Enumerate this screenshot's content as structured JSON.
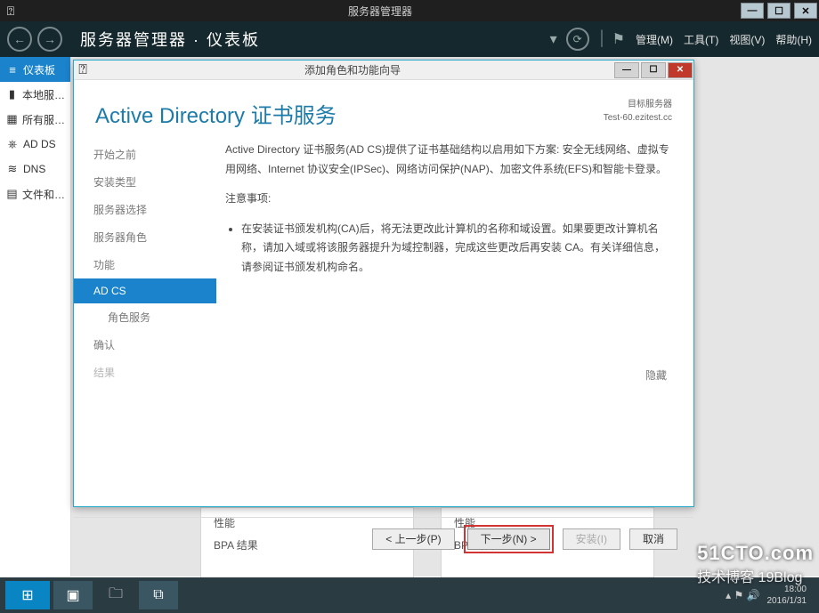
{
  "outerWindow": {
    "title": "服务器管理器",
    "breadcrumb": "服务器管理器 · 仪表板",
    "menus": {
      "manage": "管理(M)",
      "tools": "工具(T)",
      "view": "视图(V)",
      "help": "帮助(H)"
    }
  },
  "sidebar": {
    "items": [
      {
        "icon": "≡",
        "label": "仪表板",
        "sel": true
      },
      {
        "icon": "▮",
        "label": "本地服…"
      },
      {
        "icon": "▦",
        "label": "所有服…"
      },
      {
        "icon": "⎈",
        "label": "AD DS"
      },
      {
        "icon": "≋",
        "label": "DNS"
      },
      {
        "icon": "▤",
        "label": "文件和…"
      }
    ]
  },
  "panels": {
    "a_line1": "性能",
    "a_line2": "BPA 结果",
    "b_line1": "性能",
    "b_line2": "BPA 结果"
  },
  "wizard": {
    "title": "添加角色和功能向导",
    "heading": "Active Directory 证书服务",
    "destLabel": "目标服务器",
    "destServer": "Test-60.ezitest.cc",
    "steps": [
      {
        "label": "开始之前"
      },
      {
        "label": "安装类型"
      },
      {
        "label": "服务器选择"
      },
      {
        "label": "服务器角色"
      },
      {
        "label": "功能"
      },
      {
        "label": "AD CS",
        "active": true
      },
      {
        "label": "角色服务",
        "lvl2": true
      },
      {
        "label": "确认"
      },
      {
        "label": "结果",
        "disabled": true
      }
    ],
    "para1": "Active Directory 证书服务(AD CS)提供了证书基础结构以启用如下方案: 安全无线网络、虚拟专用网络、Internet 协议安全(IPSec)、网络访问保护(NAP)、加密文件系统(EFS)和智能卡登录。",
    "noteTitle": "注意事项:",
    "bullet1": "在安装证书颁发机构(CA)后，将无法更改此计算机的名称和域设置。如果要更改计算机名称，请加入域或将该服务器提升为域控制器，完成这些更改后再安装 CA。有关详细信息，请参阅证书颁发机构命名。",
    "hideLink": "隐藏",
    "buttons": {
      "prev": "< 上一步(P)",
      "next": "下一步(N) >",
      "install": "安装(I)",
      "cancel": "取消"
    }
  },
  "taskbar": {
    "time": "18:00",
    "date": "2016/1/31"
  },
  "watermark": {
    "site": "51CTO.com",
    "sub": "技术博客  19Blog"
  }
}
